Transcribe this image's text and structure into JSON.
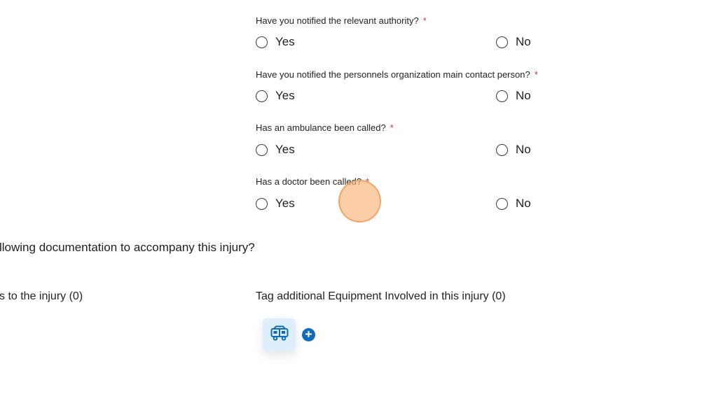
{
  "questions": [
    {
      "label": "Have you notified the relevant authority?",
      "required": "*",
      "yes": "Yes",
      "no": "No"
    },
    {
      "label": "Have you notified the personnels organization main contact person?",
      "required": "*",
      "yes": "Yes",
      "no": "No"
    },
    {
      "label": "Has an ambulance been called?",
      "required": "*",
      "yes": "Yes",
      "no": "No"
    },
    {
      "label": "Has a doctor been called?",
      "required": "*",
      "yes": "Yes",
      "no": "No"
    }
  ],
  "documentation": {
    "heading": "llowing documentation to accompany this injury?"
  },
  "tags": {
    "left_label": "s to the injury (0)",
    "equipment_label": "Tag additional Equipment Involved in this injury (0)",
    "equipment_icon": "equipment-vehicle-icon",
    "add_icon": "plus-circle-icon"
  },
  "colors": {
    "required": "#d13438",
    "accent": "#0f6cbd",
    "tile_bg": "#dfeefb",
    "click_marker": "#f7b27a"
  }
}
